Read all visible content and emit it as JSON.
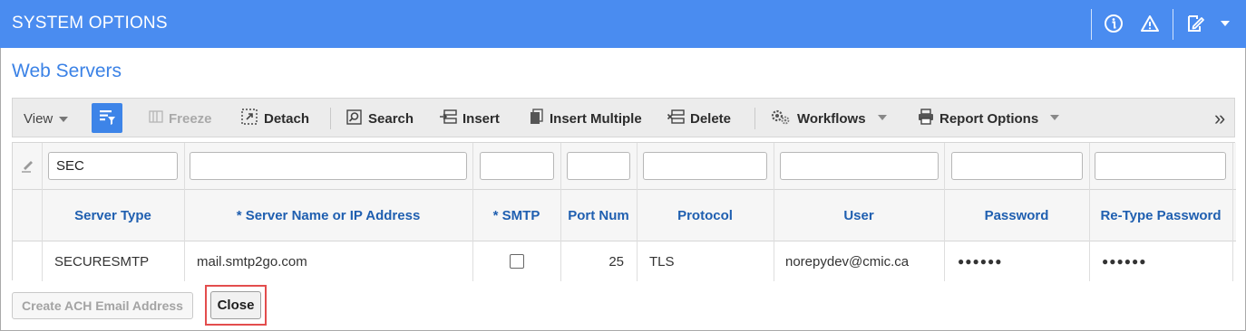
{
  "header": {
    "title": "SYSTEM OPTIONS",
    "icons": [
      "info-icon",
      "warning-icon",
      "edit-note-icon",
      "caret-down-icon"
    ]
  },
  "section": {
    "title": "Web Servers"
  },
  "toolbar": {
    "view_label": "View",
    "freeze_label": "Freeze",
    "detach_label": "Detach",
    "search_label": "Search",
    "insert_label": "Insert",
    "insert_multiple_label": "Insert Multiple",
    "delete_label": "Delete",
    "workflows_label": "Workflows",
    "report_options_label": "Report Options",
    "overflow_glyph": "»"
  },
  "filters": {
    "server_type": "SEC",
    "server_name": "",
    "smtp": "",
    "port_num": "",
    "protocol": "",
    "user": "",
    "password": "",
    "retype_password": ""
  },
  "columns": [
    "Server Type",
    "* Server Name or IP Address",
    "* SMTP",
    "Port Num",
    "Protocol",
    "User",
    "Password",
    "Re-Type Password"
  ],
  "rows": [
    {
      "server_type": "SECURESMTP",
      "server_name": "mail.smtp2go.com",
      "smtp_checked": false,
      "port_num": "25",
      "protocol": "TLS",
      "user": "norepydev@cmic.ca",
      "password": "●●●●●●",
      "retype_password": "●●●●●●"
    }
  ],
  "buttons": {
    "create_ach": "Create ACH Email Address",
    "close": "Close"
  },
  "colors": {
    "header_bg": "#4a8cf0",
    "section_title": "#3b82e6",
    "column_header": "#1f5fb0",
    "highlight": "#e34d4d"
  }
}
